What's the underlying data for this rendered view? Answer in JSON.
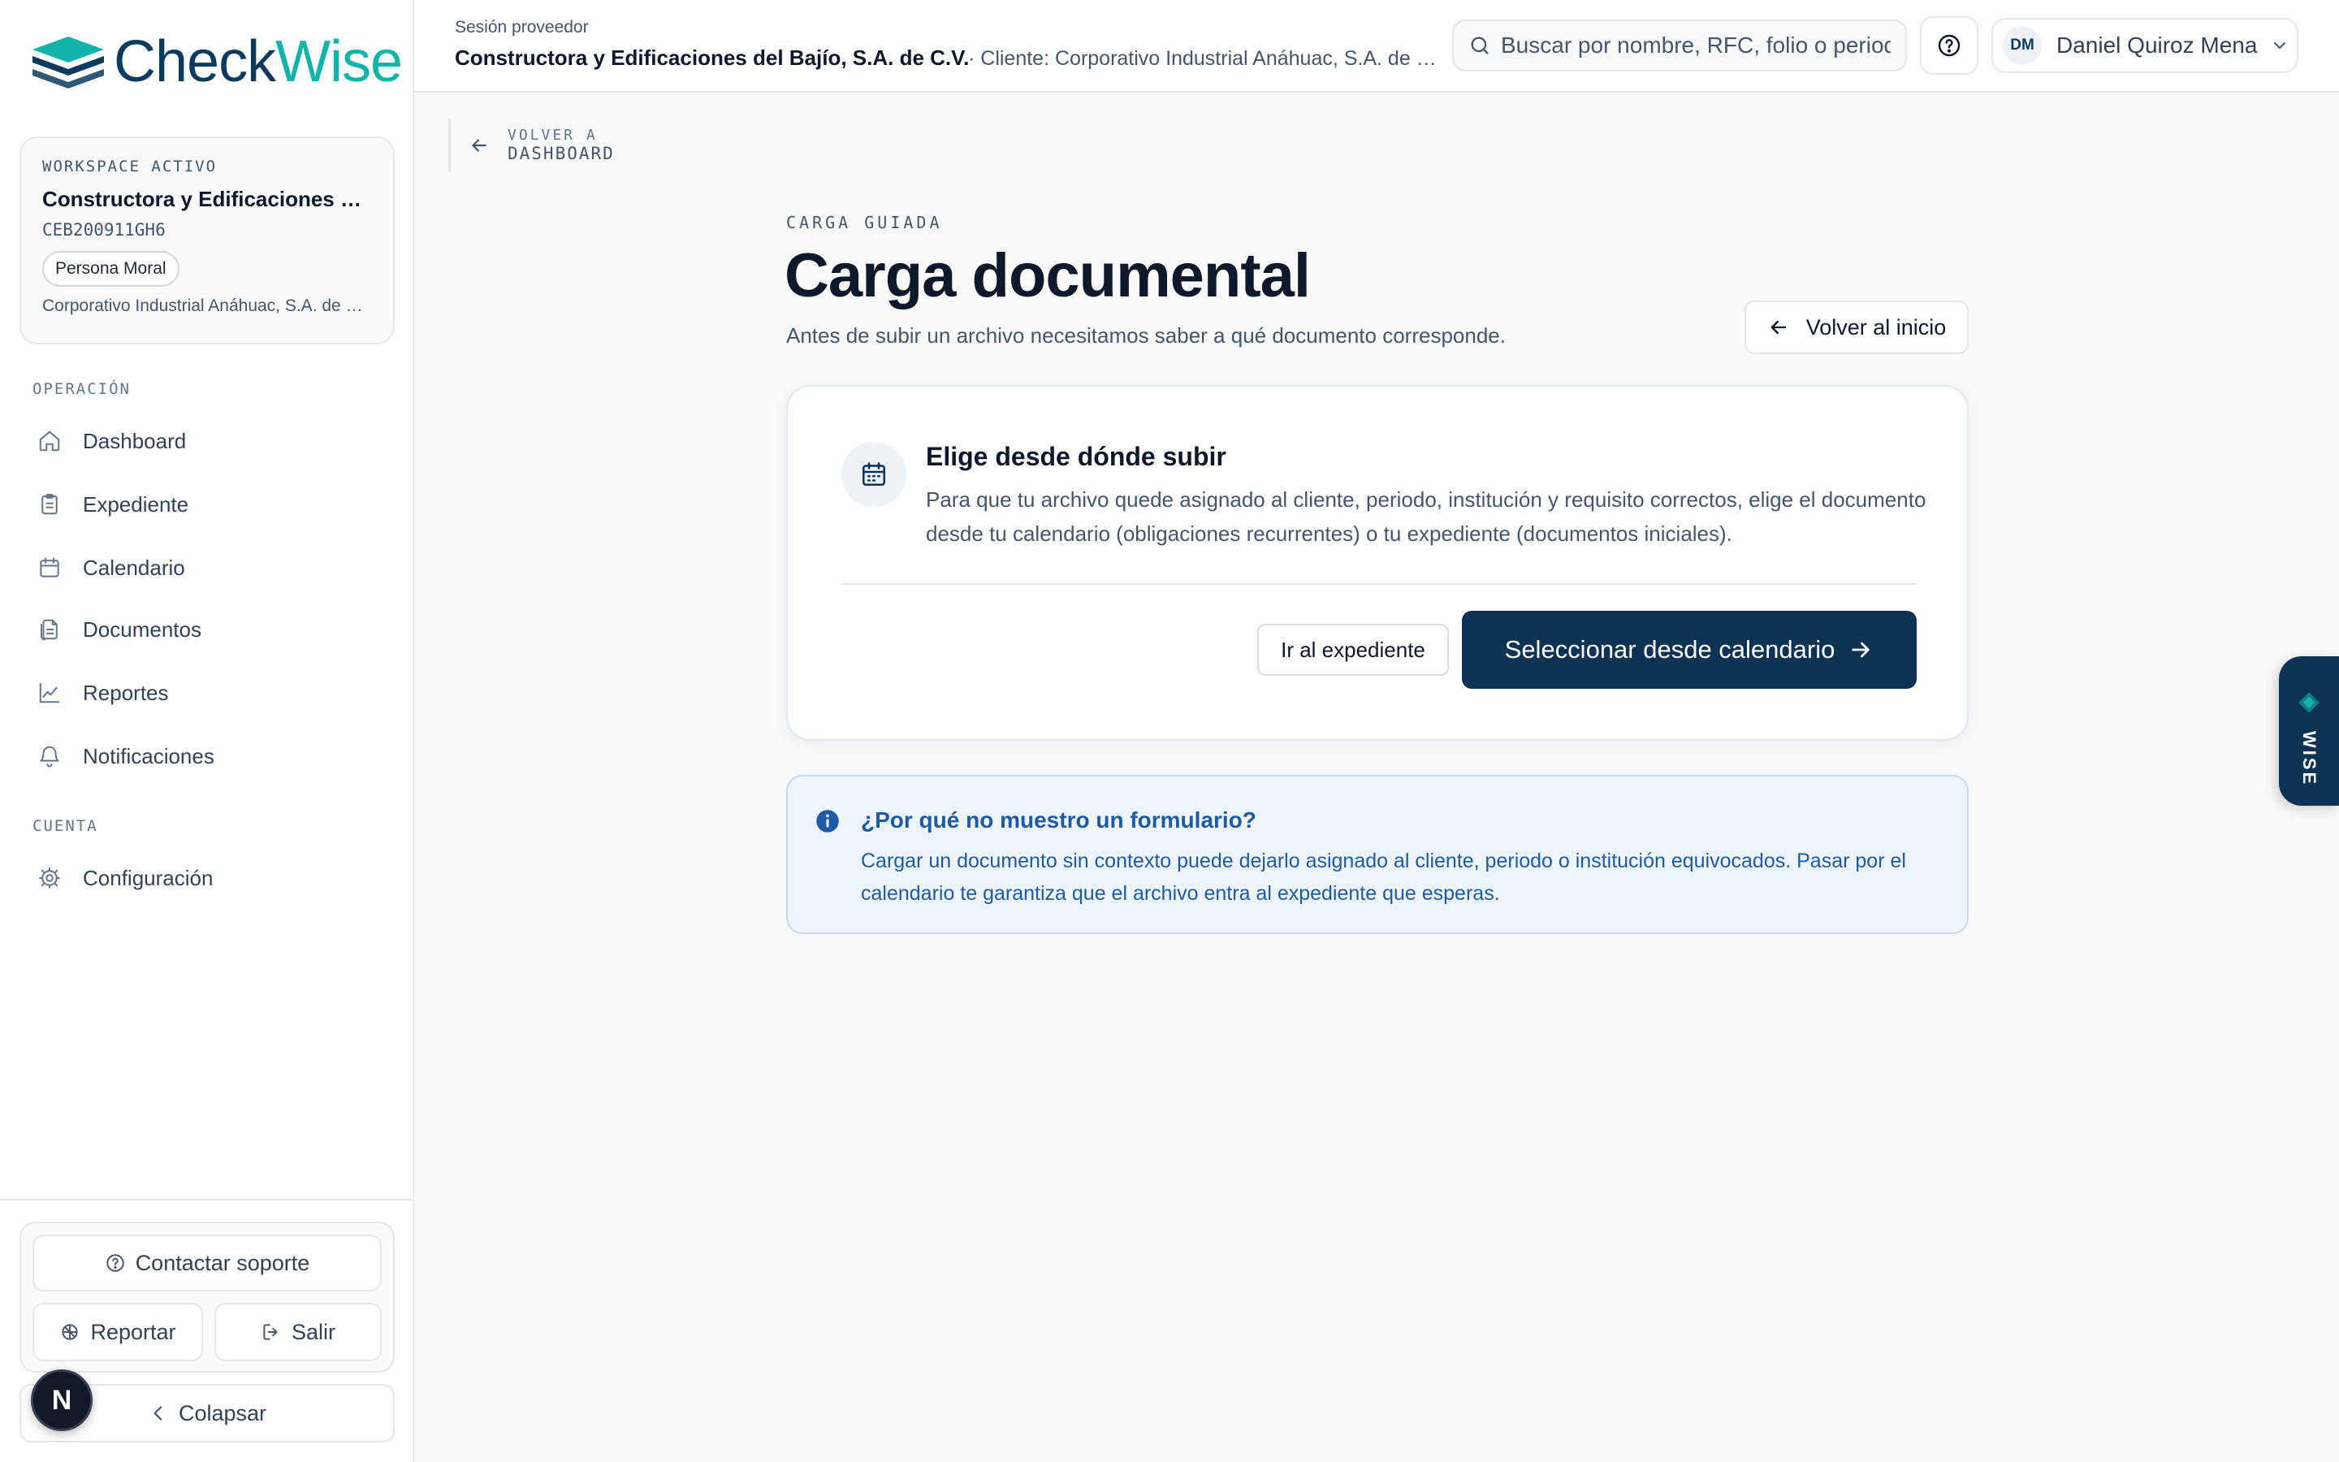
{
  "sidebar": {
    "brand": {
      "name_a": "Check",
      "name_b": "Wise"
    },
    "workspace": {
      "label": "WORKSPACE ACTIVO",
      "name": "Constructora y Edificaciones del Bajío, S.A. de C.V.",
      "rfc": "CEB200911GH6",
      "badge": "Persona Moral",
      "client": "Corporativo Industrial Anáhuac, S.A. de C.V."
    },
    "section_operacion": "OPERACIÓN",
    "nav": [
      {
        "label": "Dashboard",
        "icon": "home-icon"
      },
      {
        "label": "Expediente",
        "icon": "clipboard-icon"
      },
      {
        "label": "Calendario",
        "icon": "calendar-icon"
      },
      {
        "label": "Documentos",
        "icon": "documents-icon"
      },
      {
        "label": "Reportes",
        "icon": "chart-icon"
      },
      {
        "label": "Notificaciones",
        "icon": "bell-icon"
      }
    ],
    "section_cuenta": "CUENTA",
    "config_label": "Configuración",
    "support_label": "Contactar soporte",
    "report_label": "Reportar",
    "logout_label": "Salir",
    "collapse_label": "Colapsar",
    "dev_badge": "N"
  },
  "header": {
    "session_label": "Sesión proveedor",
    "company": "Constructora y Edificaciones del Bajío, S.A. de C.V.",
    "client": "· Cliente: Corporativo Industrial Anáhuac, S.A. de C.V.",
    "search_placeholder": "Buscar por nombre, RFC, folio o periodo",
    "user_initials": "DM",
    "user_name": "Daniel Quiroz Mena"
  },
  "back": {
    "line1": "VOLVER A",
    "line2": "DASHBOARD"
  },
  "main": {
    "kicker": "CARGA GUIADA",
    "title": "Carga documental",
    "subtitle": "Antes de subir un archivo necesitamos saber a qué documento corresponde.",
    "home_button": "Volver al inicio",
    "card": {
      "title": "Elige desde dónde subir",
      "description": "Para que tu archivo quede asignado al cliente, periodo, institución y requisito correctos, elige el documento desde tu calendario (obligaciones recurrentes) o tu expediente (documentos iniciales).",
      "secondary_button": "Ir al expediente",
      "primary_button": "Seleccionar desde calendario"
    },
    "info": {
      "title": "¿Por qué no muestro un formulario?",
      "text": "Cargar un documento sin contexto puede dejarlo asignado al cliente, periodo o institución equivocados. Pasar por el calendario te garantiza que el archivo entra al expediente que esperas."
    }
  },
  "wise_tab": {
    "label": "WISE"
  },
  "colors": {
    "primary": "#0c3354",
    "brand_teal": "#12b3a8",
    "info_blue": "#1e5aa8"
  }
}
